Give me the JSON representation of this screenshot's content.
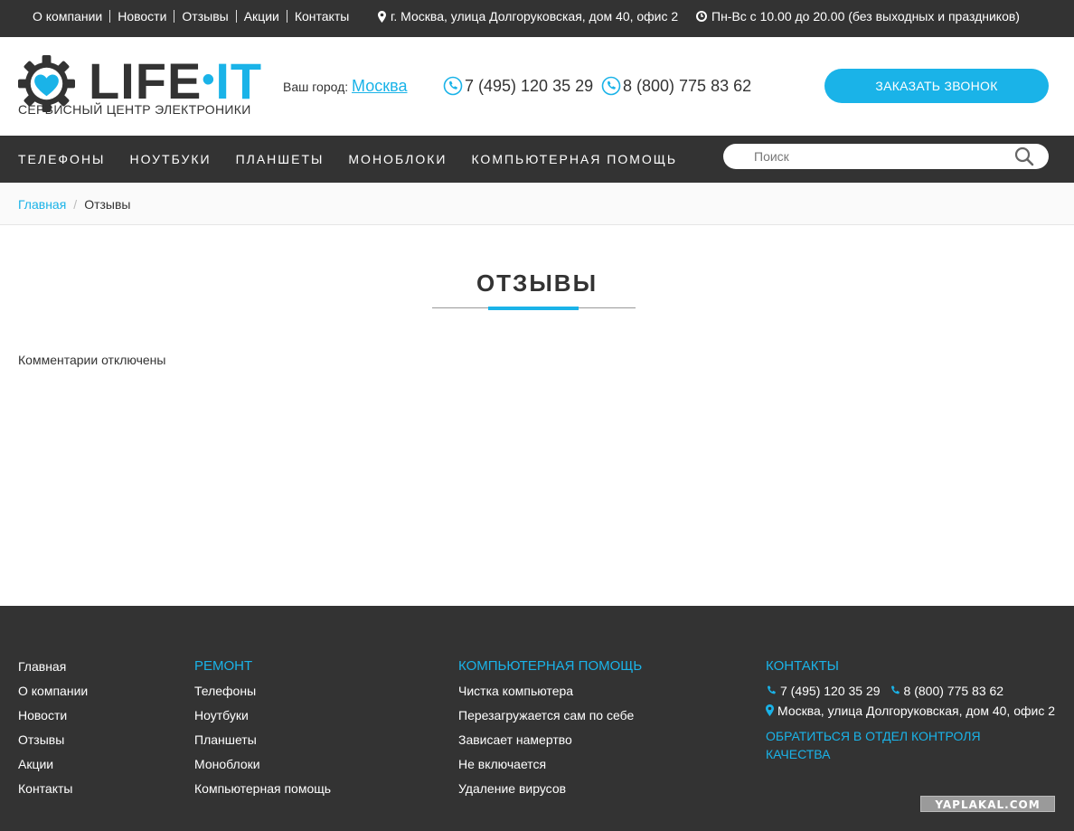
{
  "topbar": {
    "links": [
      "О компании",
      "Новости",
      "Отзывы",
      "Акции",
      "Контакты"
    ],
    "address": "г. Москва, улица Долгоруковская, дом 40, офис 2",
    "hours": "Пн-Вс с 10.00 до 20.00 (без выходных и праздников)",
    "address_icon": "map-marker-icon",
    "hours_icon": "clock-icon"
  },
  "header": {
    "logo_text_life": "LIFE",
    "logo_text_it": "IT",
    "tagline": "СЕРВИСНЫЙ ЦЕНТР ЭЛЕКТРОНИКИ",
    "city_label": "Ваш город:",
    "city": "Москва",
    "phone1": "7 (495) 120 35 29",
    "phone2": "8 (800) 775 83 62",
    "call_button": "ЗАКАЗАТЬ ЗВОНОК",
    "accent_color": "#1ab3e8"
  },
  "nav": {
    "items": [
      "ТЕЛЕФОНЫ",
      "НОУТБУКИ",
      "ПЛАНШЕТЫ",
      "МОНОБЛОКИ",
      "КОМПЬЮТЕРНАЯ ПОМОЩЬ"
    ],
    "search_placeholder": "Поиск"
  },
  "breadcrumb": {
    "home": "Главная",
    "separator": "/",
    "current": "Отзывы"
  },
  "content": {
    "title": "ОТЗЫВЫ",
    "note": "Комментарии отключены"
  },
  "footer": {
    "col1": [
      "Главная",
      "О компании",
      "Новости",
      "Отзывы",
      "Акции",
      "Контакты"
    ],
    "col2_heading": "РЕМОНТ",
    "col2": [
      "Телефоны",
      "Ноутбуки",
      "Планшеты",
      "Моноблоки",
      "Компьютерная помощь"
    ],
    "col3_heading": "КОМПЬЮТЕРНАЯ ПОМОЩЬ",
    "col3": [
      "Чистка компьютера",
      "Перезагружается сам по себе",
      "Зависает намертво",
      "Не включается",
      "Удаление вирусов"
    ],
    "col4_heading": "КОНТАКТЫ",
    "phone1": "7 (495) 120 35 29",
    "phone2": "8 (800) 775 83 62",
    "address": "Москва, улица Долгоруковская, дом 40, офис 2",
    "quality_link": "ОБРАТИТЬСЯ В ОТДЕЛ КОНТРОЛЯ КАЧЕСТВА",
    "watermark": "YAPLAKAL.COM"
  }
}
